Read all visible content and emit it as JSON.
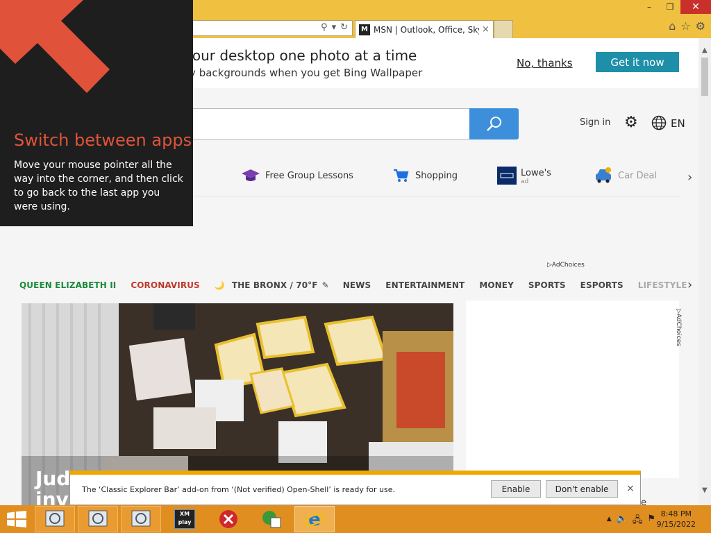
{
  "browser": {
    "tab_title": "MSN | Outlook, Office, Sky...",
    "tab_close": "×",
    "favicon": "M",
    "minimize": "–",
    "restore": "❐",
    "close": "✕",
    "search_glyph": "⚲",
    "dropdown_glyph": "▾",
    "refresh_glyph": "↻",
    "home_glyph": "⌂",
    "star_glyph": "☆",
    "tools_glyph": "⚙"
  },
  "banner": {
    "title": "n your desktop one photo at a time",
    "subtitle": "daily backgrounds when you get Bing Wallpaper",
    "no_thanks": "No, thanks",
    "get_it_now": "Get it now"
  },
  "header": {
    "sign_in": "Sign in",
    "gear": "⚙",
    "language": "EN"
  },
  "quicklinks": {
    "items": [
      {
        "label": "Free Group Lessons",
        "sub": ""
      },
      {
        "label": "Shopping",
        "sub": ""
      },
      {
        "label": "Lowe's",
        "sub": "ad"
      },
      {
        "label": "Car Deal",
        "sub": ""
      }
    ],
    "next": "›"
  },
  "adchoices": "AdChoices",
  "nav": {
    "items": [
      {
        "label": "QUEEN ELIZABETH II",
        "color": "#1a8a3a"
      },
      {
        "label": "CORONAVIRUS",
        "color": "#c0392b"
      },
      {
        "label": "🌙",
        "color": "#e8b400"
      },
      {
        "label": "THE BRONX / 70°F",
        "color": "#444444"
      },
      {
        "label": "✎",
        "color": "#444444"
      },
      {
        "label": "NEWS",
        "color": "#444444"
      },
      {
        "label": "ENTERTAINMENT",
        "color": "#444444"
      },
      {
        "label": "MONEY",
        "color": "#444444"
      },
      {
        "label": "SPORTS",
        "color": "#444444"
      },
      {
        "label": "ESPORTS",
        "color": "#444444"
      },
      {
        "label": "LIFESTYLE",
        "color": "#aaaaaa"
      }
    ],
    "next": "›"
  },
  "hero": {
    "caption_line1": "Judg",
    "caption_line2": "inve"
  },
  "peek": "ailable",
  "charms_hint": {
    "title": "Switch between apps",
    "body": "Move your mouse pointer all the way into the corner, and then click to go back to the last app you were using."
  },
  "notification": {
    "text": "The ‘Classic Explorer Bar’ add-on from ‘(Not verified) Open-Shell’ is ready for use.",
    "enable": "Enable",
    "dont_enable": "Don't enable",
    "close": "×"
  },
  "taskbar": {
    "xmplay_label": "XM play",
    "time": "8:48 PM",
    "date": "9/15/2022",
    "tray_chevron": "▲"
  },
  "colors": {
    "ie_frame": "#f0c040",
    "taskbar": "#e08e20",
    "accent_button": "#1e8fa8",
    "search_button": "#3d8fdc",
    "hint_title": "#e0533a",
    "notification_accent": "#f0a800"
  }
}
